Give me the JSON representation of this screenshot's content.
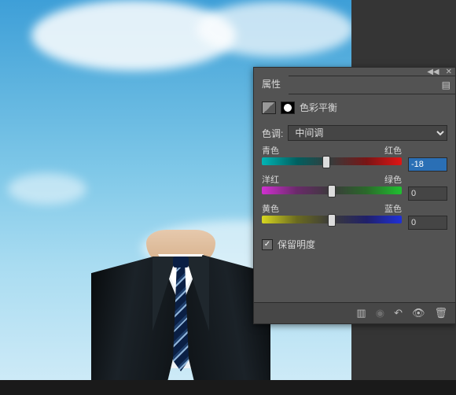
{
  "panel": {
    "title": "属性",
    "adjustment_name": "色彩平衡",
    "tone_label": "色调:",
    "tone_value": "中间调",
    "sliders": [
      {
        "left": "青色",
        "right": "红色",
        "value": "-18",
        "thumb_pct": 46,
        "track": "t-cr",
        "highlight": true
      },
      {
        "left": "洋红",
        "right": "绿色",
        "value": "0",
        "thumb_pct": 50,
        "track": "t-mg",
        "highlight": false
      },
      {
        "left": "黄色",
        "right": "蓝色",
        "value": "0",
        "thumb_pct": 50,
        "track": "t-yb",
        "highlight": false
      }
    ],
    "preserve_luminosity": "保留明度",
    "preserve_checked": true
  }
}
